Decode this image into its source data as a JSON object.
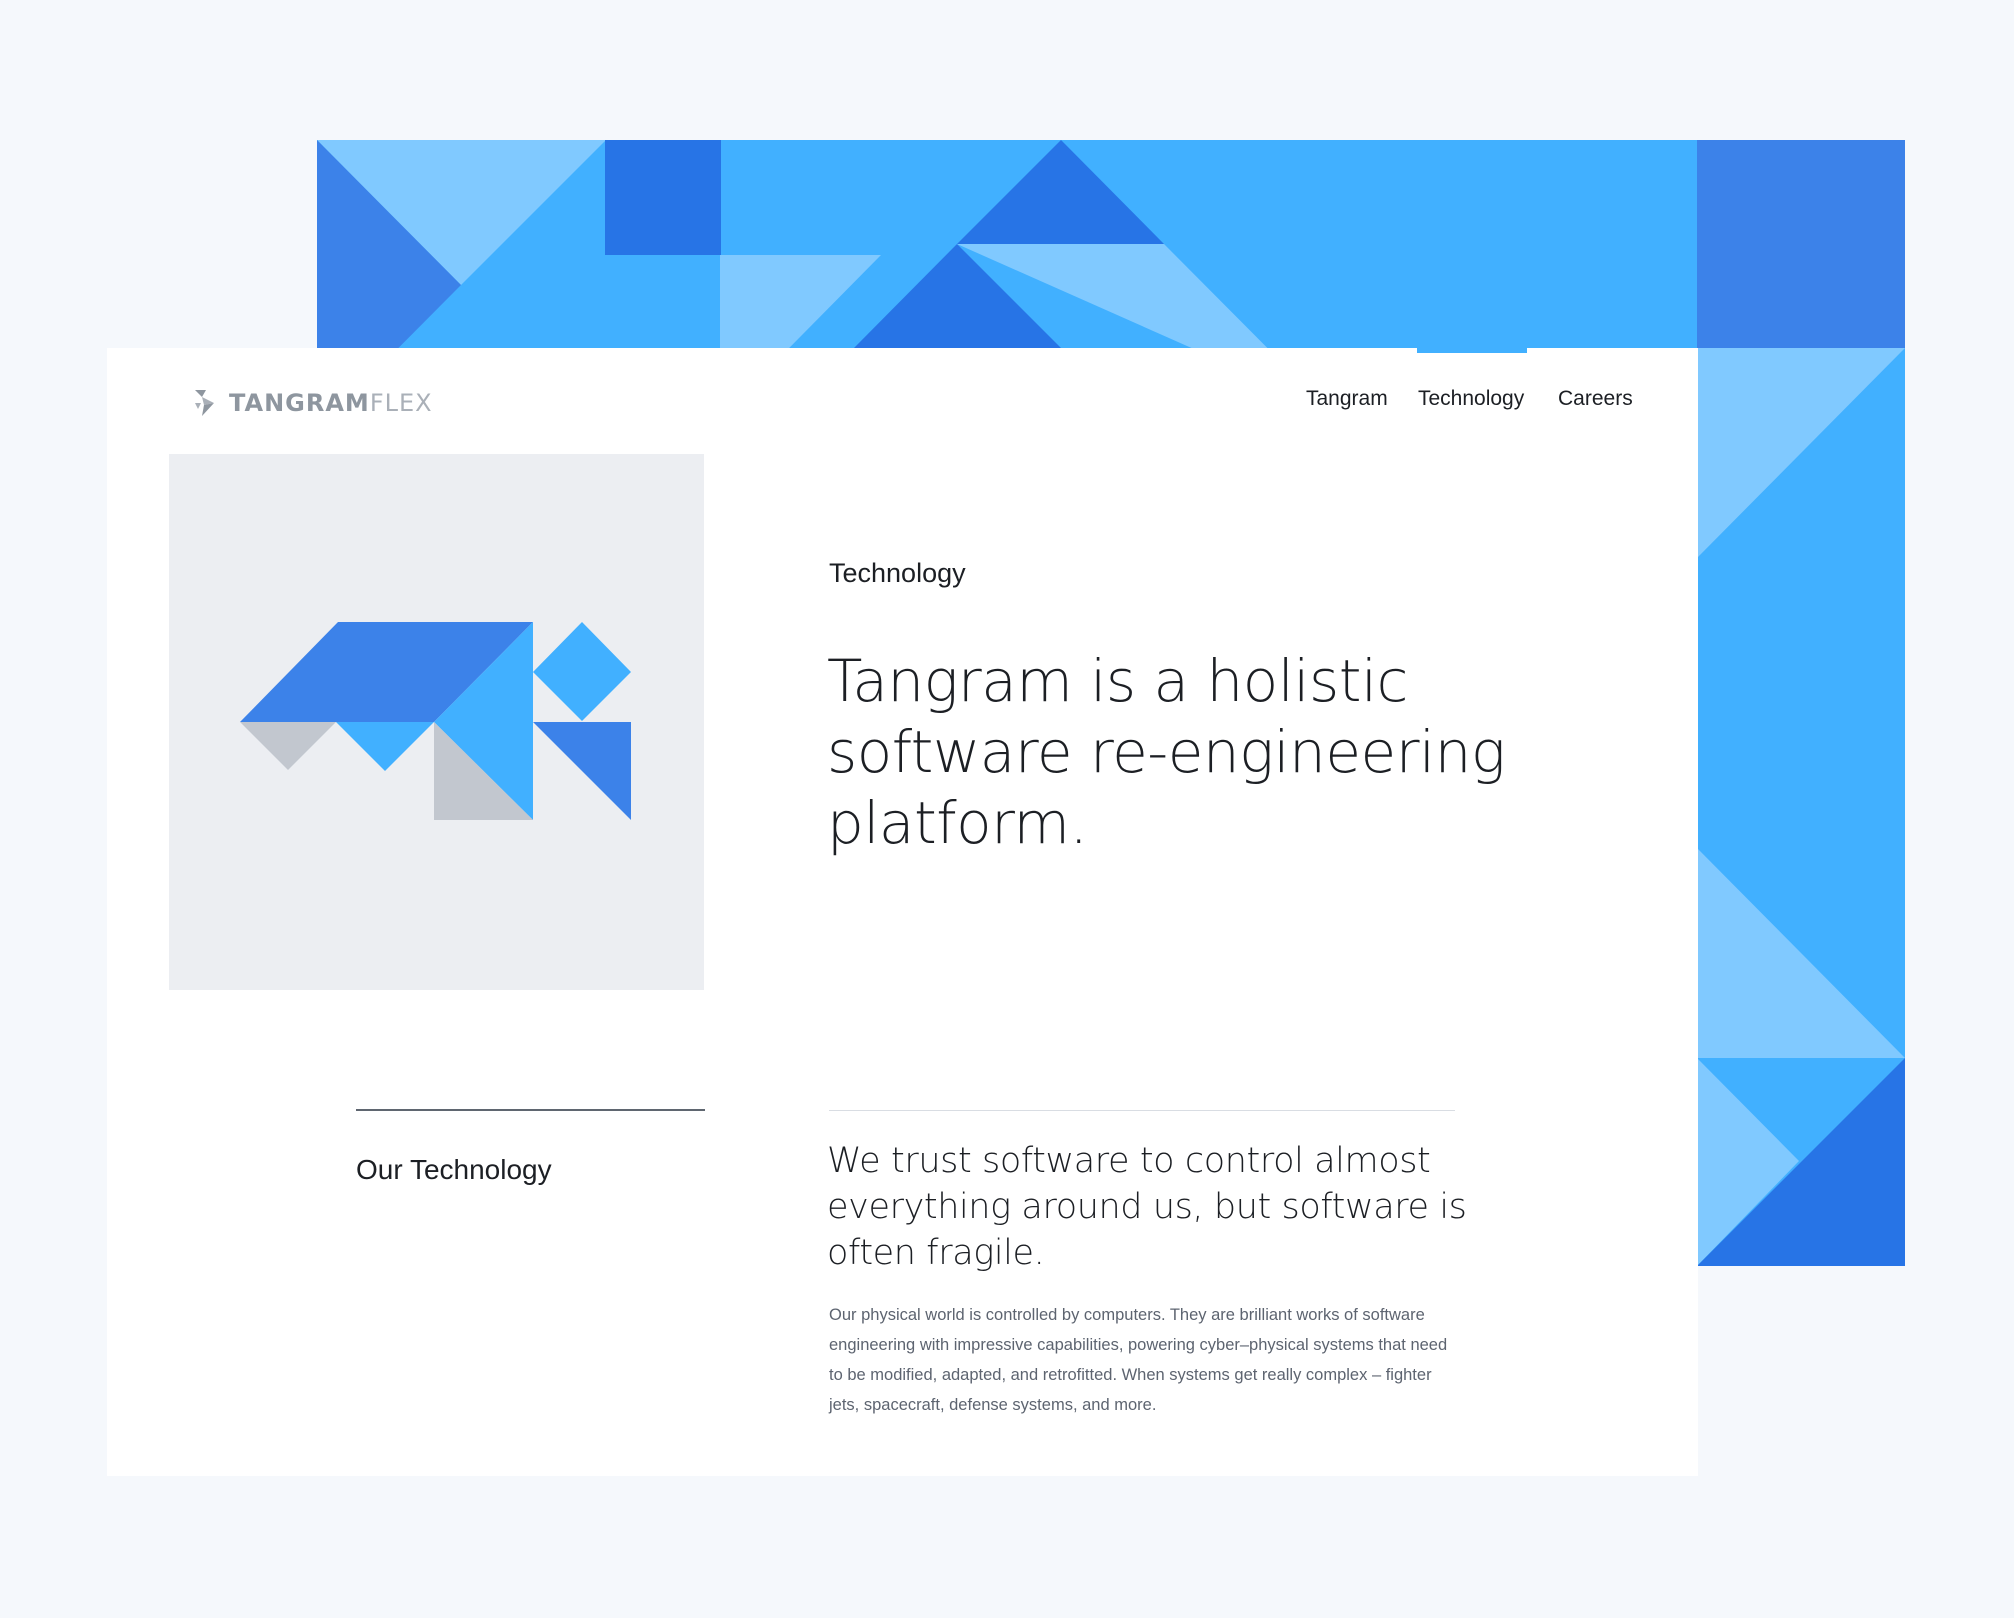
{
  "colors": {
    "page_background": "#f5f8fc",
    "card_background": "#ffffff",
    "tile_background": "#eceef2",
    "blue_light": "#80c9ff",
    "blue_sky": "#41b0ff",
    "blue_mid": "#3c82e9",
    "blue_dark": "#2774e6",
    "gray_shape": "#c2c7cf",
    "text_dark": "#1c1f24",
    "text_muted": "#5d6470",
    "logo_gray": "#8e969f"
  },
  "logo": {
    "word_strong": "TANGRAM",
    "word_light": "FLEX",
    "icon": "tangram-arrow-logo-icon"
  },
  "nav": {
    "items": [
      {
        "label": "Tangram",
        "active": false
      },
      {
        "label": "Technology",
        "active": true
      },
      {
        "label": "Careers",
        "active": false
      }
    ]
  },
  "hero": {
    "eyebrow": "Technology",
    "headline": "Tangram is a holistic software re-engineering platform.",
    "illustration": "tangram-animal-illustration"
  },
  "section": {
    "label": "Our Technology",
    "heading": "We trust software to control almost everything around us, but software is often fragile.",
    "body": "Our physical world is controlled by computers. They are brilliant works of software engineering with impressive capabilities, powering cyber–physical systems that need to be modified, adapted, and retrofitted. When systems get really complex – fighter jets, spacecraft, defense systems, and more."
  }
}
